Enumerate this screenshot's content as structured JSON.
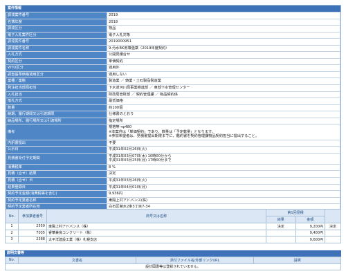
{
  "summary": {
    "title": "案件情報",
    "rows": [
      {
        "label": "調達案件番号",
        "value": "2019"
      },
      {
        "label": "名簿年度",
        "value": "2018"
      },
      {
        "label": "調達区分",
        "value": "物品"
      },
      {
        "label": "電子入札案件区分",
        "value": "電子入札対象"
      },
      {
        "label": "調達案件番号",
        "value": "2019000951"
      },
      {
        "label": "調達案件名称",
        "value": "9.汚水BK用壊強薬〈2019年度契約〉"
      },
      {
        "label": "入札方式",
        "value": "公開見積合せ"
      },
      {
        "label": "契約区分",
        "value": "単価契約"
      },
      {
        "label": "WTO区分",
        "value": "適用外"
      },
      {
        "label": "調査基準価格適用区分",
        "value": "適用しない"
      },
      {
        "label": "業種／業態",
        "value": "製造業 ／ 鋳業・土石製品製造業"
      },
      {
        "label": "発注担当部局担当",
        "value": "下水道河川局事業推進部 ／ 東部下水管理センター"
      },
      {
        "label": "入札担当",
        "value": "財政局管財部 ／ 契約管理課 ／ 物品契約係"
      },
      {
        "label": "落札方式",
        "value": "最低価格"
      },
      {
        "label": "数量",
        "value": "約100個"
      },
      {
        "label": "納期、履行期間又は引渡期限",
        "value": "仕様書のとおり"
      },
      {
        "label": "納品場所、履行場所又は引渡場所",
        "value": "指定場所"
      },
      {
        "label": "備考",
        "value_lines": [
          "規格等→φ480",
          "※本案件は「単価契約」であり、数量は「予定数量」となります。",
          "※参加希望者は、見積書提出期限までに、鑑約書を契約管理課物品契約担当に提出すること。"
        ]
      },
      {
        "label": "内訳書提出",
        "value": "不要"
      },
      {
        "label": "公示日",
        "value": "平成31年02月26日(火)"
      },
      {
        "label": "見積書受付予定期間",
        "value_lines": [
          "平成31年03月07日(木) 10時00分から",
          "平成31年03月25日(月) 17時00分まで"
        ]
      },
      {
        "label": "消費税率",
        "value": "8 %"
      },
      {
        "label": "見積（合せ）結果",
        "value": "決定"
      },
      {
        "label": "見積（合せ）日",
        "value": "平成31年03月26日(火)"
      },
      {
        "label": "結果登録日",
        "value": "平成31年04月01日(月)"
      },
      {
        "label": "契約予定金額(消費税等を含む)",
        "value": "9,936円"
      },
      {
        "label": "契約予定業者名称",
        "value": "東陽上村アドバンス(株)"
      },
      {
        "label": "契約予定業者所在地",
        "value": "白石区菊水2条3丁目7-34"
      }
    ]
  },
  "bids": {
    "headers": {
      "no": "No.",
      "reg": "参加業者番号",
      "company": "商号又は名称",
      "round": "第1回見積",
      "result": "結果",
      "amount": "金額"
    },
    "rows": [
      {
        "no": "1",
        "reg": "2559",
        "company": "東陽上村アドバンス（株）",
        "result": "決定",
        "amount": "9,200円",
        "final": "決定"
      },
      {
        "no": "2",
        "reg": "7035",
        "company": "睿華兼良コンクリート（株）",
        "result": "",
        "amount": "9,400円",
        "final": ""
      },
      {
        "no": "3",
        "reg": "2388",
        "company": "太平洋建設工業（株）札幌支店",
        "result": "",
        "amount": "9,600円",
        "final": ""
      }
    ]
  },
  "docs": {
    "title": "説明文書等",
    "headers": {
      "no": "No.",
      "name": "文書名",
      "file": "添付ファイル名/外部リンクURL",
      "desc": "説明"
    },
    "empty": "設計図書等は登録されていません。"
  }
}
